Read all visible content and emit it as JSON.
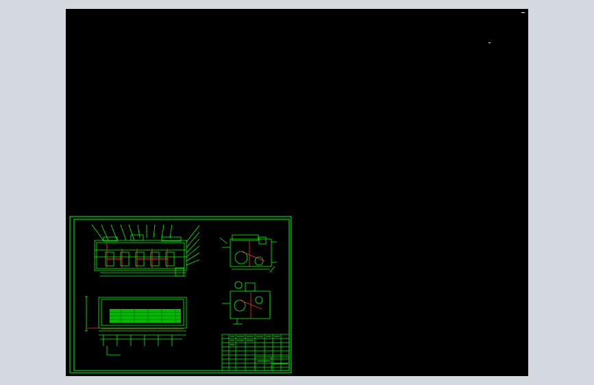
{
  "canvas": {
    "background": "#000000",
    "frame_color": "#00ff00",
    "accent_color": "#ff3030",
    "fill_color": "#00dd00"
  },
  "drawing": {
    "views": [
      "front-view",
      "side-view-upper",
      "side-view-lower",
      "plan-view",
      "title-block"
    ]
  }
}
